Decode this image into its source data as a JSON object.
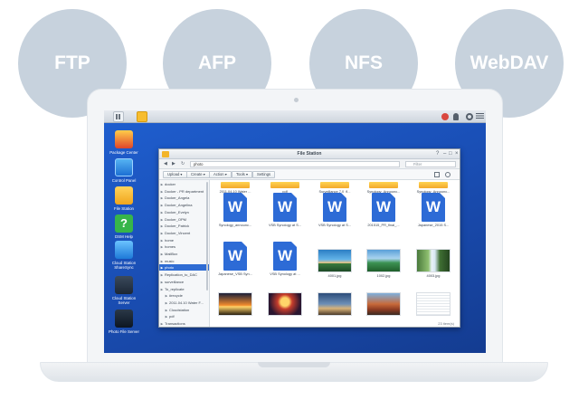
{
  "protocols": [
    "FTP",
    "AFP",
    "NFS",
    "WebDAV"
  ],
  "desktop_apps": [
    {
      "label": "Package Center",
      "icon": "package-center-icon"
    },
    {
      "label": "Control Panel",
      "icon": "control-panel-icon"
    },
    {
      "label": "File Station",
      "icon": "file-station-icon"
    },
    {
      "label": "DSM Help",
      "icon": "help-icon",
      "glyph": "?"
    },
    {
      "label": "Cloud Station ShareSync",
      "icon": "cloud-sharesync-icon"
    },
    {
      "label": "Cloud Station Server",
      "icon": "cloud-server-icon"
    },
    {
      "label": "Photo File Server",
      "icon": "photo-server-icon"
    }
  ],
  "window": {
    "title": "File Station",
    "path": "photo",
    "filter_placeholder": "Filter",
    "toolbar": [
      "Upload ▾",
      "Create ▾",
      "Action ▾",
      "Tools ▾",
      "Settings"
    ]
  },
  "tree": [
    {
      "label": "docker",
      "selected": false
    },
    {
      "label": "Docker - PR department",
      "selected": false
    },
    {
      "label": "Docker_Angela",
      "selected": false
    },
    {
      "label": "Docker_Angelina",
      "selected": false
    },
    {
      "label": "Docker_Evelyn",
      "selected": false
    },
    {
      "label": "Docker_OPM",
      "selected": false
    },
    {
      "label": "Docker_Patrick",
      "selected": false
    },
    {
      "label": "Docker_Vincent",
      "selected": false
    },
    {
      "label": "home",
      "selected": false
    },
    {
      "label": "homes",
      "selected": false
    },
    {
      "label": "MailBox",
      "selected": false
    },
    {
      "label": "music",
      "selected": false
    },
    {
      "label": "photo",
      "selected": true
    },
    {
      "label": "Replication_to_DAC",
      "selected": false
    },
    {
      "label": "surveillance",
      "selected": false
    },
    {
      "label": "To_replicate",
      "selected": false
    },
    {
      "label": "#recycle",
      "selected": false
    },
    {
      "label": "2011.04.10 Water F...",
      "selected": false
    },
    {
      "label": "Cloudstation",
      "selected": false
    },
    {
      "label": "pdf",
      "selected": false
    },
    {
      "label": "Transactions",
      "selected": false
    }
  ],
  "files": [
    {
      "kind": "folder",
      "name": "2011.04.10 Water ..."
    },
    {
      "kind": "folder",
      "name": "pdf"
    },
    {
      "kind": "folder",
      "name": "Surveillance 7.0_fl..."
    },
    {
      "kind": "folder",
      "name": "Synology_Announc..."
    },
    {
      "kind": "folder",
      "name": "Synology_Announc..."
    },
    {
      "kind": "doc",
      "name": "Synology_announc..."
    },
    {
      "kind": "doc",
      "name": "VSB Synology at S..."
    },
    {
      "kind": "doc",
      "name": "VSB Synology at S..."
    },
    {
      "kind": "doc",
      "name": "201515_PR_final_..."
    },
    {
      "kind": "doc",
      "name": "Japanese_2015 S..."
    },
    {
      "kind": "doc",
      "name": "Japanese_VSB Syn..."
    },
    {
      "kind": "doc",
      "name": "VSB Synology at ..."
    },
    {
      "kind": "photo",
      "name": "4001.jpg",
      "style": "ph1"
    },
    {
      "kind": "photo",
      "name": "1002.jpg",
      "style": "ph2"
    },
    {
      "kind": "photo",
      "name": "4003.jpg",
      "style": "ph3"
    },
    {
      "kind": "photo",
      "name": "",
      "style": "ph4"
    },
    {
      "kind": "photo",
      "name": "",
      "style": "ph5"
    },
    {
      "kind": "photo",
      "name": "",
      "style": "ph6"
    },
    {
      "kind": "photo",
      "name": "",
      "style": "ph7"
    },
    {
      "kind": "photo",
      "name": "",
      "style": "ph8"
    }
  ],
  "item_count": "23 item(s)"
}
